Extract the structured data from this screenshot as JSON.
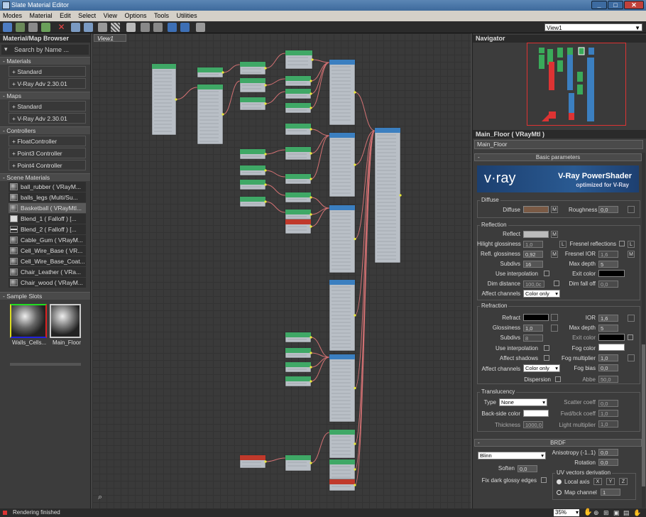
{
  "window": {
    "title": "Slate Material Editor"
  },
  "menu": [
    "Modes",
    "Material",
    "Edit",
    "Select",
    "View",
    "Options",
    "Tools",
    "Utilities"
  ],
  "toolbar": {
    "view_selector": "View1"
  },
  "browser": {
    "title": "Material/Map Browser",
    "search_placeholder": "Search by Name ...",
    "sections": {
      "materials": {
        "title": "- Materials",
        "items": [
          "+ Standard",
          "+ V-Ray Adv 2.30.01"
        ]
      },
      "maps": {
        "title": "- Maps",
        "items": [
          "+ Standard",
          "+ V-Ray Adv 2.30.01"
        ]
      },
      "controllers": {
        "title": "- Controllers",
        "items": [
          "+ FloatController",
          "+ Point3 Controller",
          "+ Point4 Controller"
        ]
      },
      "scene": {
        "title": "- Scene Materials",
        "items": [
          "ball_rubber  ( VRayM...",
          "balls_legs  (Multi/Su...",
          "Basketball  ( VRayMtl...",
          "Blend_1  ( Falloff )  [...",
          "Blend_2  ( Falloff )  [...",
          "Cable_Gum  ( VRayM...",
          "Cell_Wire_Base  ( VR...",
          "Cell_Wire_Base_Coat...",
          "Chair_Leather  ( VRa...",
          "Chair_wood  ( VRayM..."
        ]
      },
      "samples": {
        "title": "- Sample Slots",
        "slots": [
          "Walls_Cells...",
          "Main_Floor"
        ]
      }
    }
  },
  "canvas": {
    "tab": "View1"
  },
  "navigator": {
    "title": "Navigator"
  },
  "editor": {
    "title": "Main_Floor  ( VRayMtl )",
    "name": "Main_Floor",
    "rollout": "Basic parameters",
    "banner": {
      "logo": "v·ray",
      "line1": "V-Ray PowerShader",
      "line2": "optimized for V-Ray"
    },
    "diffuse": {
      "group": "Diffuse",
      "label": "Diffuse",
      "m": "M",
      "roughness_label": "Roughness",
      "roughness": "0,0",
      "color": "#7a5a45"
    },
    "reflection": {
      "group": "Reflection",
      "reflect": "Reflect",
      "m": "M",
      "hilight_label": "Hilight glossiness",
      "hilight": "1,0",
      "L": "L",
      "fresnel_label": "Fresnel reflections",
      "L2": "L",
      "refl_gloss_label": "Refl. glossiness",
      "refl_gloss": "0,92",
      "m2": "M",
      "fresnel_ior_label": "Fresnel IOR",
      "fresnel_ior": "1,6",
      "m3": "M",
      "subdivs_label": "Subdivs",
      "subdivs": "16",
      "max_depth_label": "Max depth",
      "max_depth": "5",
      "use_interp": "Use interpolation",
      "exit_color": "Exit color",
      "dim_dist_label": "Dim distance",
      "dim_dist": "100,0c",
      "dim_falloff_label": "Dim fall off",
      "dim_falloff": "0,0",
      "affect_label": "Affect channels",
      "affect": "Color only"
    },
    "refraction": {
      "group": "Refraction",
      "refract": "Refract",
      "ior_label": "IOR",
      "ior": "1,6",
      "gloss_label": "Glossiness",
      "gloss": "1,0",
      "max_depth_label": "Max depth",
      "max_depth": "5",
      "subdivs_label": "Subdivs",
      "subdivs": "8",
      "exit_color": "Exit color",
      "use_interp": "Use interpolation",
      "fog_color": "Fog color",
      "affect_shadows": "Affect shadows",
      "fog_mult_label": "Fog multiplier",
      "fog_mult": "1,0",
      "affect_label": "Affect channels",
      "affect": "Color only",
      "fog_bias_label": "Fog bias",
      "fog_bias": "0,0",
      "dispersion": "Dispersion",
      "abbe_label": "Abbe",
      "abbe": "50,0"
    },
    "translucency": {
      "group": "Translucency",
      "type_label": "Type",
      "type": "None",
      "scatter_label": "Scatter coeff",
      "scatter": "0,0",
      "backside_label": "Back-side color",
      "fwdbck_label": "Fwd/bck coeff",
      "fwdbck": "1,0",
      "thickness_label": "Thickness",
      "thickness": "1000,0",
      "light_mult_label": "Light multiplier",
      "light_mult": "1,0"
    },
    "brdf": {
      "rollout": "BRDF",
      "type": "Blinn",
      "aniso_label": "Anisotropy (-1..1)",
      "aniso": "0,0",
      "rotation_label": "Rotation",
      "rotation": "0,0",
      "soften_label": "Soften",
      "soften": "0,0",
      "uv_label": "UV vectors derivation",
      "fix_label": "Fix dark glossy edges",
      "local_axis": "Local axis",
      "x": "X",
      "y": "Y",
      "z": "Z",
      "map_channel": "Map channel",
      "map_channel_val": "1"
    }
  },
  "status": {
    "text": "Rendering finished",
    "zoom": "35%"
  }
}
